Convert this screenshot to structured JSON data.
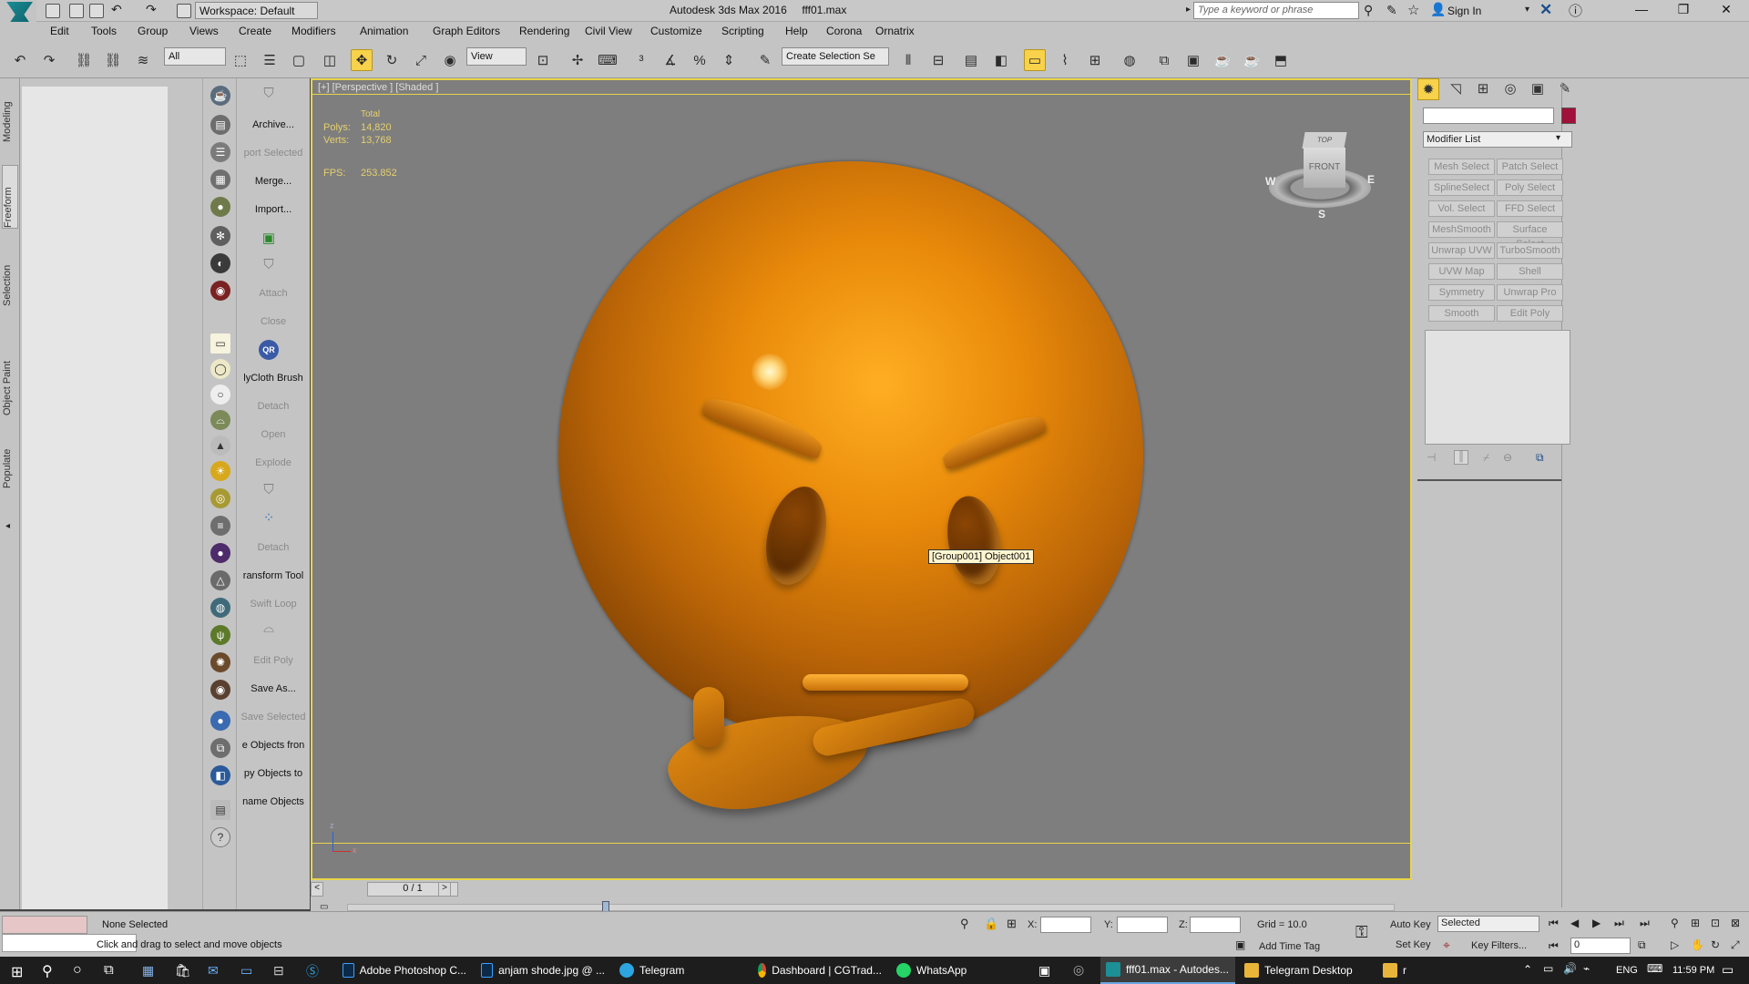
{
  "title_bar": {
    "workspace": "Workspace: Default",
    "title": "Autodesk 3ds Max 2016     fff01.max",
    "search_placeholder": "Type a keyword or phrase",
    "sign_in": "Sign In"
  },
  "menu": [
    "Edit",
    "Tools",
    "Group",
    "Views",
    "Create",
    "Modifiers",
    "Animation",
    "Graph Editors",
    "Rendering",
    "Civil View",
    "Customize",
    "Scripting",
    "Help",
    "Corona",
    "Ornatrix"
  ],
  "toolbar": {
    "filter": "All",
    "ref_coord": "View",
    "selection_set": "Create Selection Se"
  },
  "ribbon_tabs": [
    "Modeling",
    "Freeform",
    "Selection",
    "Object Paint",
    "Populate"
  ],
  "script_panel": {
    "items": [
      "Archive...",
      "port Selected",
      "Merge...",
      "Import...",
      "Attach",
      "Close",
      "lyCloth Brush",
      "Detach",
      "Open",
      "Explode",
      "Detach",
      "ransform Tool",
      "Swift Loop",
      "Edit Poly",
      "Save As...",
      "Save Selected",
      "e Objects fron",
      "py Objects to",
      "name Objects"
    ],
    "qr_label": "QR"
  },
  "viewport": {
    "label": "[+] [Perspective ] [Shaded ]",
    "stats_header": "Total",
    "polys_label": "Polys:",
    "polys_value": "14,820",
    "verts_label": "Verts:",
    "verts_value": "13,768",
    "fps_label": "FPS:",
    "fps_value": "253.852",
    "tooltip": "[Group001] Object001",
    "viewcube_top": "TOP",
    "viewcube_front": "FRONT",
    "viewcube_w": "W",
    "viewcube_e": "E",
    "viewcube_s": "S",
    "axis_x": "x",
    "axis_z": "z"
  },
  "timeline": {
    "frame": "0 / 1"
  },
  "status": {
    "selection": "None Selected",
    "prompt": "Click and drag to select and move objects",
    "x_label": "X:",
    "y_label": "Y:",
    "z_label": "Z:",
    "grid": "Grid = 10.0",
    "add_time_tag": "Add Time Tag",
    "auto_key": "Auto Key",
    "set_key": "Set Key",
    "selected": "Selected",
    "key_filters": "Key Filters...",
    "frame_value": "0"
  },
  "command_panel": {
    "modifier_list": "Modifier List",
    "color_swatch": "#a0103a",
    "buttons": [
      [
        "Mesh Select",
        "Patch Select"
      ],
      [
        "SplineSelect",
        "Poly Select"
      ],
      [
        "Vol. Select",
        "FFD Select"
      ],
      [
        "MeshSmooth",
        "Surface Select"
      ],
      [
        "Unwrap UVW",
        "TurboSmooth"
      ],
      [
        "UVW Map",
        "Shell"
      ],
      [
        "Symmetry",
        "Unwrap Pro"
      ],
      [
        "Smooth",
        "Edit Poly"
      ]
    ]
  },
  "taskbar": {
    "apps": [
      "Adobe Photoshop C...",
      "anjam shode.jpg @ ...",
      "Telegram",
      "Dashboard | CGTrad...",
      "WhatsApp",
      "fff01.max - Autodes...",
      "Telegram Desktop",
      "r"
    ],
    "lang": "ENG",
    "time": "11:59 PM"
  }
}
